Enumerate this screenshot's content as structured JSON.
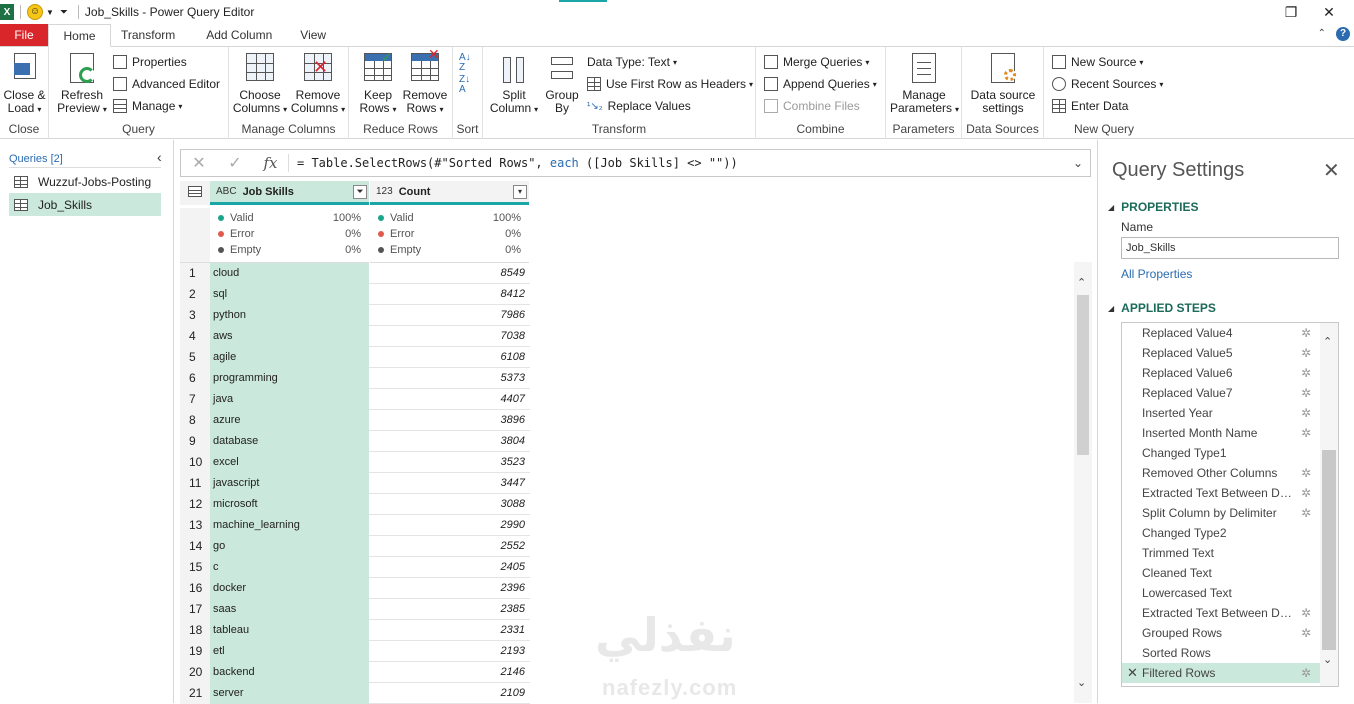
{
  "window": {
    "title": "Job_Skills - Power Query Editor",
    "excel_logo": "X",
    "restore_icon": "restore-icon",
    "close_icon": "close-icon"
  },
  "tabs": [
    {
      "label": "File"
    },
    {
      "label": "Home"
    },
    {
      "label": "Transform"
    },
    {
      "label": "Add Column"
    },
    {
      "label": "View"
    }
  ],
  "ribbon": {
    "close_group": {
      "label": "Close",
      "close_load": "Close &",
      "close_load2": "Load"
    },
    "query_group": {
      "label": "Query",
      "refresh": "Refresh",
      "refresh2": "Preview",
      "properties": "Properties",
      "advanced_editor": "Advanced Editor",
      "manage": "Manage"
    },
    "manage_columns_group": {
      "label": "Manage Columns",
      "choose": "Choose",
      "choose2": "Columns",
      "remove": "Remove",
      "remove2": "Columns"
    },
    "reduce_rows_group": {
      "label": "Reduce Rows",
      "keep": "Keep",
      "keep2": "Rows",
      "remove": "Remove",
      "remove2": "Rows"
    },
    "sort_group": {
      "label": "Sort"
    },
    "transform_group": {
      "label": "Transform",
      "split": "Split",
      "split2": "Column",
      "group": "Group",
      "group2": "By",
      "data_type": "Data Type: Text",
      "first_row": "Use First Row as Headers",
      "replace": "Replace Values"
    },
    "combine_group": {
      "label": "Combine",
      "merge": "Merge Queries",
      "append": "Append Queries",
      "combine_files": "Combine Files"
    },
    "parameters_group": {
      "label": "Parameters",
      "manage": "Manage",
      "manage2": "Parameters"
    },
    "data_sources_group": {
      "label": "Data Sources",
      "settings": "Data source",
      "settings2": "settings"
    },
    "new_query_group": {
      "label": "New Query",
      "new_source": "New Source",
      "recent": "Recent Sources",
      "enter_data": "Enter Data"
    }
  },
  "queries_pane": {
    "header": "Queries [2]",
    "items": [
      {
        "label": "Wuzzuf-Jobs-Posting"
      },
      {
        "label": "Job_Skills"
      }
    ]
  },
  "formula_bar": {
    "prefix": "= Table.SelectRows(#\"Sorted Rows\", ",
    "keyword": "each",
    "suffix": " ([Job Skills] <> \"\"))"
  },
  "grid": {
    "columns": [
      {
        "type": "ABC",
        "name": "Job Skills"
      },
      {
        "type": "123",
        "name": "Count"
      }
    ],
    "quality": [
      {
        "label": "Valid",
        "value": "100%",
        "color": "#1aa68a"
      },
      {
        "label": "Error",
        "value": "0%",
        "color": "#e05a4e"
      },
      {
        "label": "Empty",
        "value": "0%",
        "color": "#555555"
      }
    ],
    "rows": [
      {
        "n": "1",
        "skill": "cloud",
        "count": "8549"
      },
      {
        "n": "2",
        "skill": "sql",
        "count": "8412"
      },
      {
        "n": "3",
        "skill": "python",
        "count": "7986"
      },
      {
        "n": "4",
        "skill": "aws",
        "count": "7038"
      },
      {
        "n": "5",
        "skill": "agile",
        "count": "6108"
      },
      {
        "n": "6",
        "skill": "programming",
        "count": "5373"
      },
      {
        "n": "7",
        "skill": "java",
        "count": "4407"
      },
      {
        "n": "8",
        "skill": "azure",
        "count": "3896"
      },
      {
        "n": "9",
        "skill": "database",
        "count": "3804"
      },
      {
        "n": "10",
        "skill": "excel",
        "count": "3523"
      },
      {
        "n": "11",
        "skill": "javascript",
        "count": "3447"
      },
      {
        "n": "12",
        "skill": "microsoft",
        "count": "3088"
      },
      {
        "n": "13",
        "skill": "machine_learning",
        "count": "2990"
      },
      {
        "n": "14",
        "skill": "go",
        "count": "2552"
      },
      {
        "n": "15",
        "skill": "c",
        "count": "2405"
      },
      {
        "n": "16",
        "skill": "docker",
        "count": "2396"
      },
      {
        "n": "17",
        "skill": "saas",
        "count": "2385"
      },
      {
        "n": "18",
        "skill": "tableau",
        "count": "2331"
      },
      {
        "n": "19",
        "skill": "etl",
        "count": "2193"
      },
      {
        "n": "20",
        "skill": "backend",
        "count": "2146"
      },
      {
        "n": "21",
        "skill": "server",
        "count": "2109"
      }
    ]
  },
  "watermark": {
    "arabic": "نفذلي",
    "latin": "nafezly.com"
  },
  "settings": {
    "title": "Query Settings",
    "properties_header": "PROPERTIES",
    "name_label": "Name",
    "name_value": "Job_Skills",
    "all_properties": "All Properties",
    "steps_header": "APPLIED STEPS",
    "steps": [
      {
        "label": "Replaced Value4",
        "gear": true
      },
      {
        "label": "Replaced Value5",
        "gear": true
      },
      {
        "label": "Replaced Value6",
        "gear": true
      },
      {
        "label": "Replaced Value7",
        "gear": true
      },
      {
        "label": "Inserted Year",
        "gear": true
      },
      {
        "label": "Inserted Month Name",
        "gear": true
      },
      {
        "label": "Changed Type1",
        "gear": false
      },
      {
        "label": "Removed Other Columns",
        "gear": true
      },
      {
        "label": "Extracted Text Between Del...",
        "gear": true
      },
      {
        "label": "Split Column by Delimiter",
        "gear": true
      },
      {
        "label": "Changed Type2",
        "gear": false
      },
      {
        "label": "Trimmed Text",
        "gear": false
      },
      {
        "label": "Cleaned Text",
        "gear": false
      },
      {
        "label": "Lowercased Text",
        "gear": false
      },
      {
        "label": "Extracted Text Between Del...",
        "gear": true
      },
      {
        "label": "Grouped Rows",
        "gear": true
      },
      {
        "label": "Sorted Rows",
        "gear": false
      },
      {
        "label": "Filtered Rows",
        "gear": true,
        "selected": true
      }
    ]
  }
}
